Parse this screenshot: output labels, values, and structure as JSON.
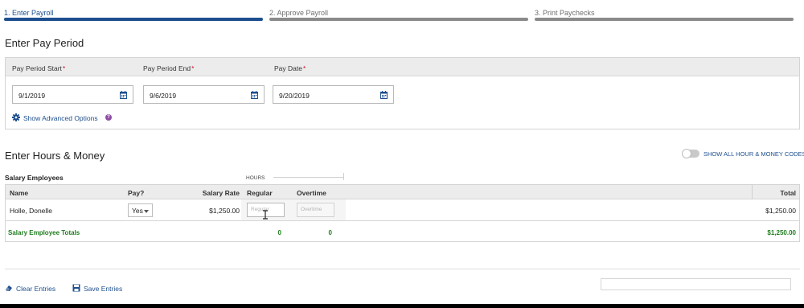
{
  "stepper": {
    "steps": [
      {
        "label": "1. Enter Payroll",
        "active": true
      },
      {
        "label": "2. Approve Payroll",
        "active": false
      },
      {
        "label": "3. Print Paychecks",
        "active": false
      }
    ]
  },
  "pay_period": {
    "title": "Enter Pay Period",
    "fields": [
      {
        "label": "Pay Period Start",
        "value": "9/1/2019",
        "required_mark": "*"
      },
      {
        "label": "Pay Period End",
        "value": "9/6/2019",
        "required_mark": "*"
      },
      {
        "label": "Pay Date",
        "value": "9/20/2019",
        "required_mark": "*"
      }
    ],
    "advanced_label": "Show Advanced Options",
    "help_glyph": "?"
  },
  "hours_money": {
    "title": "Enter Hours & Money",
    "toggle_label": "SHOW ALL HOUR & MONEY CODES",
    "toggle_on": false,
    "group_label": "Salary Employees",
    "hours_group_label": "HOURS"
  },
  "table": {
    "columns": {
      "name": "Name",
      "pay": "Pay?",
      "rate": "Salary Rate",
      "regular": "Regular",
      "overtime": "Overtime",
      "total": "Total"
    },
    "rows": [
      {
        "name": "Holle, Donelle",
        "pay": "Yes",
        "rate": "$1,250.00",
        "regular_placeholder": "Regular",
        "overtime_placeholder": "Overtime",
        "total": "$1,250.00"
      }
    ],
    "totals": {
      "label": "Salary Employee Totals",
      "regular": "0",
      "overtime": "0",
      "total": "$1,250.00"
    }
  },
  "actions": {
    "clear_label": "Clear Entries",
    "save_label": "Save Entries"
  },
  "colors": {
    "accent": "#1d4f8f",
    "totals_green": "#1e7d1e",
    "required_red": "#c8102e",
    "help_purple": "#8e4ea6"
  }
}
